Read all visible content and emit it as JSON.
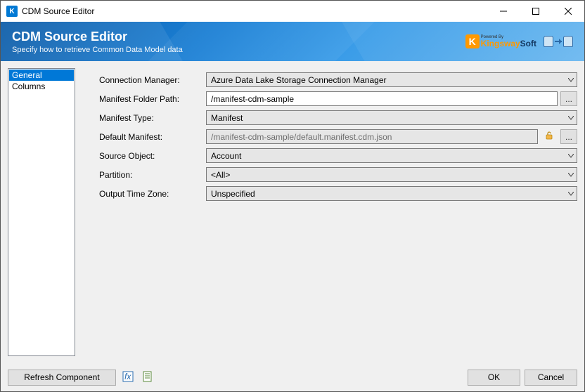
{
  "titlebar": {
    "title": "CDM Source Editor"
  },
  "banner": {
    "heading": "CDM Source Editor",
    "subheading": "Specify how to retrieve Common Data Model data",
    "powered_by": "Powered By",
    "brand_orange": "Kingsway",
    "brand_dark": "Soft"
  },
  "sidebar": {
    "items": [
      {
        "label": "General",
        "selected": true
      },
      {
        "label": "Columns",
        "selected": false
      }
    ]
  },
  "form": {
    "connection_manager": {
      "label": "Connection Manager:",
      "value": "Azure Data Lake Storage Connection Manager"
    },
    "manifest_folder_path": {
      "label": "Manifest Folder Path:",
      "value": "/manifest-cdm-sample",
      "browse": "..."
    },
    "manifest_type": {
      "label": "Manifest Type:",
      "value": "Manifest"
    },
    "default_manifest": {
      "label": "Default Manifest:",
      "value": "/manifest-cdm-sample/default.manifest.cdm.json",
      "browse": "..."
    },
    "source_object": {
      "label": "Source Object:",
      "value": "Account"
    },
    "partition": {
      "label": "Partition:",
      "value": "<All>"
    },
    "output_time_zone": {
      "label": "Output Time Zone:",
      "value": "Unspecified"
    }
  },
  "footer": {
    "refresh": "Refresh Component",
    "ok": "OK",
    "cancel": "Cancel"
  }
}
